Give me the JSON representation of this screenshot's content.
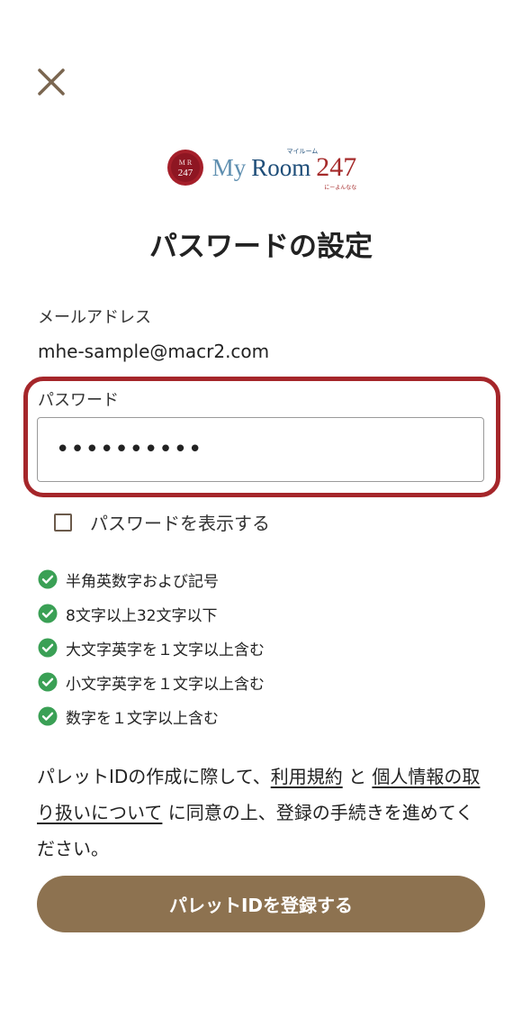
{
  "logo": {
    "seal_top": "M R",
    "seal_bottom": "247",
    "word_my": "My",
    "word_room": "Room",
    "number": "247",
    "kana_top": "マイルーム",
    "kana_bottom": "にーよんなな"
  },
  "title": "パスワードの設定",
  "email": {
    "label": "メールアドレス",
    "value": "mhe-sample@macr2.com"
  },
  "password": {
    "label": "パスワード",
    "value": "••••••••••"
  },
  "show_password": {
    "label": "パスワードを表示する",
    "checked": false
  },
  "rules": [
    "半角英数字および記号",
    "8文字以上32文字以下",
    "大文字英字を１文字以上含む",
    "小文字英字を１文字以上含む",
    "数字を１文字以上含む"
  ],
  "consent": {
    "prefix": "パレットIDの作成に際して、",
    "terms_link": "利用規約",
    "connector": "と",
    "privacy_link": "個人情報の取り扱いについて",
    "suffix": "に同意の上、登録の手続きを進めてください。"
  },
  "submit_label": "パレットIDを登録する",
  "colors": {
    "accent_brown": "#8d7250",
    "highlight_red": "#a5262a",
    "check_green": "#3aa055",
    "close_icon": "#7a6650"
  }
}
